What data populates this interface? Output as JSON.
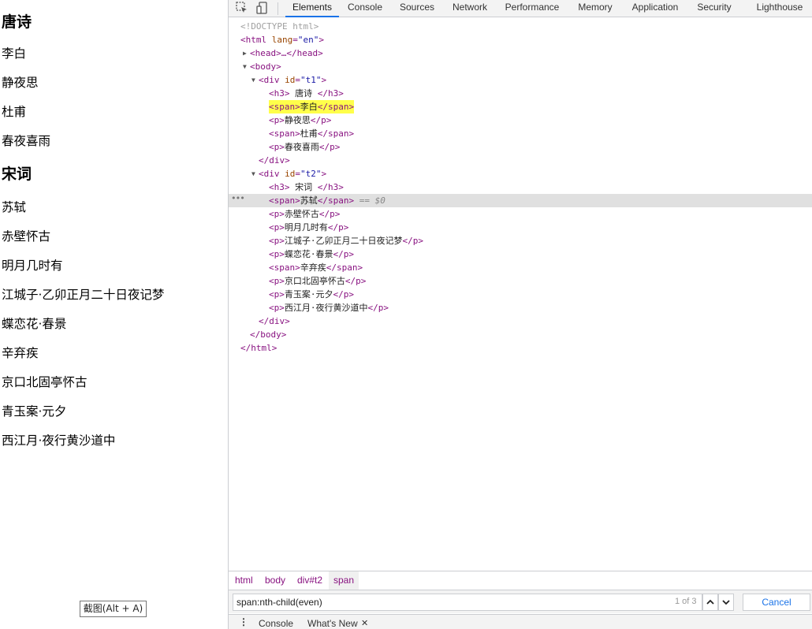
{
  "page": {
    "heading1": "唐诗",
    "t1_items": [
      "李白",
      "静夜思",
      "杜甫",
      "春夜喜雨"
    ],
    "heading2": "宋词",
    "t2_items": [
      "苏轼",
      "赤壁怀古",
      "明月几时有",
      "江城子·乙卯正月二十日夜记梦",
      "蝶恋花·春景",
      "辛弃疾",
      "京口北固亭怀古",
      "青玉案·元夕",
      "西江月·夜行黄沙道中"
    ],
    "snip_label": "截图(Alt + A)"
  },
  "devtools": {
    "tabs": [
      "Elements",
      "Console",
      "Sources",
      "Network",
      "Performance",
      "Memory",
      "Application",
      "Security",
      "Lighthouse"
    ],
    "active_tab": "Elements",
    "tree": {
      "doctype": "<!DOCTYPE html>",
      "html_open": "<html",
      "lang_attr": "lang",
      "lang_val": "\"en\"",
      "head": "<head>…</head>",
      "body_open": "<body>",
      "div_open": "<div",
      "id_attr": "id",
      "t1": "\"t1\"",
      "t2": "\"t2\"",
      "h3_open": "<h3>",
      "h3_close": "</h3>",
      "span_open": "<span>",
      "span_close": "</span>",
      "p_open": "<p>",
      "p_close": "</p>",
      "div_close": "</div>",
      "body_close": "</body>",
      "html_close": "</html>",
      "selected_marker": "== $0",
      "dots": "•••"
    },
    "breadcrumbs": [
      "html",
      "body",
      "div#t2",
      "span"
    ],
    "search": {
      "value": "span:nth-child(even)",
      "count": "1 of 3",
      "cancel_label": "Cancel"
    },
    "drawer": {
      "menu": "⋮",
      "tabs": [
        "Console",
        "What's New"
      ],
      "close": "✕"
    }
  }
}
